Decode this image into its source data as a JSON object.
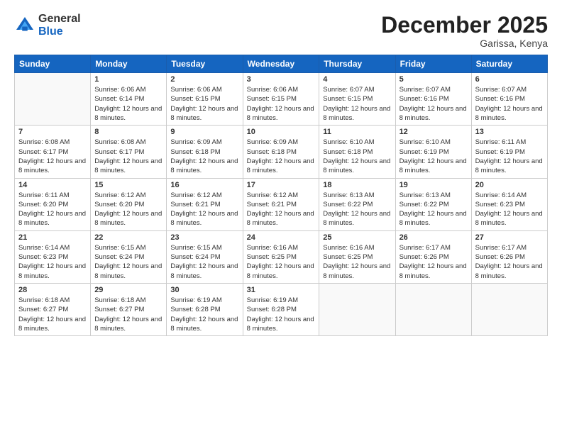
{
  "header": {
    "logo_general": "General",
    "logo_blue": "Blue",
    "month_title": "December 2025",
    "location": "Garissa, Kenya"
  },
  "weekdays": [
    "Sunday",
    "Monday",
    "Tuesday",
    "Wednesday",
    "Thursday",
    "Friday",
    "Saturday"
  ],
  "weeks": [
    [
      {
        "day": "",
        "sunrise": "",
        "sunset": "",
        "daylight": ""
      },
      {
        "day": "1",
        "sunrise": "6:06 AM",
        "sunset": "6:14 PM",
        "daylight": "12 hours and 8 minutes."
      },
      {
        "day": "2",
        "sunrise": "6:06 AM",
        "sunset": "6:15 PM",
        "daylight": "12 hours and 8 minutes."
      },
      {
        "day": "3",
        "sunrise": "6:06 AM",
        "sunset": "6:15 PM",
        "daylight": "12 hours and 8 minutes."
      },
      {
        "day": "4",
        "sunrise": "6:07 AM",
        "sunset": "6:15 PM",
        "daylight": "12 hours and 8 minutes."
      },
      {
        "day": "5",
        "sunrise": "6:07 AM",
        "sunset": "6:16 PM",
        "daylight": "12 hours and 8 minutes."
      },
      {
        "day": "6",
        "sunrise": "6:07 AM",
        "sunset": "6:16 PM",
        "daylight": "12 hours and 8 minutes."
      }
    ],
    [
      {
        "day": "7",
        "sunrise": "6:08 AM",
        "sunset": "6:17 PM",
        "daylight": "12 hours and 8 minutes."
      },
      {
        "day": "8",
        "sunrise": "6:08 AM",
        "sunset": "6:17 PM",
        "daylight": "12 hours and 8 minutes."
      },
      {
        "day": "9",
        "sunrise": "6:09 AM",
        "sunset": "6:18 PM",
        "daylight": "12 hours and 8 minutes."
      },
      {
        "day": "10",
        "sunrise": "6:09 AM",
        "sunset": "6:18 PM",
        "daylight": "12 hours and 8 minutes."
      },
      {
        "day": "11",
        "sunrise": "6:10 AM",
        "sunset": "6:18 PM",
        "daylight": "12 hours and 8 minutes."
      },
      {
        "day": "12",
        "sunrise": "6:10 AM",
        "sunset": "6:19 PM",
        "daylight": "12 hours and 8 minutes."
      },
      {
        "day": "13",
        "sunrise": "6:11 AM",
        "sunset": "6:19 PM",
        "daylight": "12 hours and 8 minutes."
      }
    ],
    [
      {
        "day": "14",
        "sunrise": "6:11 AM",
        "sunset": "6:20 PM",
        "daylight": "12 hours and 8 minutes."
      },
      {
        "day": "15",
        "sunrise": "6:12 AM",
        "sunset": "6:20 PM",
        "daylight": "12 hours and 8 minutes."
      },
      {
        "day": "16",
        "sunrise": "6:12 AM",
        "sunset": "6:21 PM",
        "daylight": "12 hours and 8 minutes."
      },
      {
        "day": "17",
        "sunrise": "6:12 AM",
        "sunset": "6:21 PM",
        "daylight": "12 hours and 8 minutes."
      },
      {
        "day": "18",
        "sunrise": "6:13 AM",
        "sunset": "6:22 PM",
        "daylight": "12 hours and 8 minutes."
      },
      {
        "day": "19",
        "sunrise": "6:13 AM",
        "sunset": "6:22 PM",
        "daylight": "12 hours and 8 minutes."
      },
      {
        "day": "20",
        "sunrise": "6:14 AM",
        "sunset": "6:23 PM",
        "daylight": "12 hours and 8 minutes."
      }
    ],
    [
      {
        "day": "21",
        "sunrise": "6:14 AM",
        "sunset": "6:23 PM",
        "daylight": "12 hours and 8 minutes."
      },
      {
        "day": "22",
        "sunrise": "6:15 AM",
        "sunset": "6:24 PM",
        "daylight": "12 hours and 8 minutes."
      },
      {
        "day": "23",
        "sunrise": "6:15 AM",
        "sunset": "6:24 PM",
        "daylight": "12 hours and 8 minutes."
      },
      {
        "day": "24",
        "sunrise": "6:16 AM",
        "sunset": "6:25 PM",
        "daylight": "12 hours and 8 minutes."
      },
      {
        "day": "25",
        "sunrise": "6:16 AM",
        "sunset": "6:25 PM",
        "daylight": "12 hours and 8 minutes."
      },
      {
        "day": "26",
        "sunrise": "6:17 AM",
        "sunset": "6:26 PM",
        "daylight": "12 hours and 8 minutes."
      },
      {
        "day": "27",
        "sunrise": "6:17 AM",
        "sunset": "6:26 PM",
        "daylight": "12 hours and 8 minutes."
      }
    ],
    [
      {
        "day": "28",
        "sunrise": "6:18 AM",
        "sunset": "6:27 PM",
        "daylight": "12 hours and 8 minutes."
      },
      {
        "day": "29",
        "sunrise": "6:18 AM",
        "sunset": "6:27 PM",
        "daylight": "12 hours and 8 minutes."
      },
      {
        "day": "30",
        "sunrise": "6:19 AM",
        "sunset": "6:28 PM",
        "daylight": "12 hours and 8 minutes."
      },
      {
        "day": "31",
        "sunrise": "6:19 AM",
        "sunset": "6:28 PM",
        "daylight": "12 hours and 8 minutes."
      },
      {
        "day": "",
        "sunrise": "",
        "sunset": "",
        "daylight": ""
      },
      {
        "day": "",
        "sunrise": "",
        "sunset": "",
        "daylight": ""
      },
      {
        "day": "",
        "sunrise": "",
        "sunset": "",
        "daylight": ""
      }
    ]
  ]
}
